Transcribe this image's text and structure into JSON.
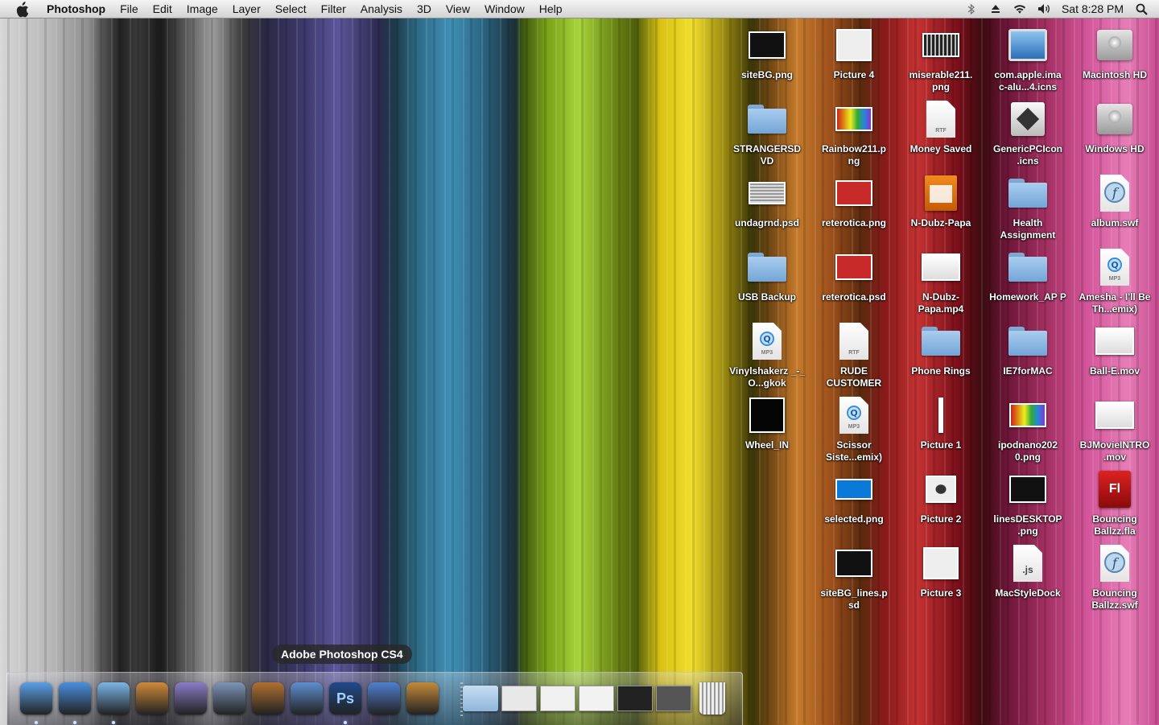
{
  "menubar": {
    "app_name": "Photoshop",
    "menus": [
      "File",
      "Edit",
      "Image",
      "Layer",
      "Select",
      "Filter",
      "Analysis",
      "3D",
      "View",
      "Window",
      "Help"
    ],
    "clock": "Sat 8:28 PM"
  },
  "desktop_icons": [
    {
      "label": "siteBG.png",
      "icon": "image-thumbnail-dark"
    },
    {
      "label": "STRANGERSD VD",
      "icon": "folder-icon"
    },
    {
      "label": "undagrnd.psd",
      "icon": "image-thumbnail-silver"
    },
    {
      "label": "USB Backup",
      "icon": "folder-icon"
    },
    {
      "label": "Vinylshakerz _-_ O...gkok",
      "icon": "mp3-file-icon"
    },
    {
      "label": "Wheel_IN",
      "icon": "image-thumbnail-black"
    },
    {
      "label": "Picture 4",
      "icon": "image-thumbnail-white"
    },
    {
      "label": "Rainbow211.p ng",
      "icon": "image-thumbnail-rainbow"
    },
    {
      "label": "reterotica.png",
      "icon": "image-thumbnail-red"
    },
    {
      "label": "reterotica.psd",
      "icon": "image-thumbnail-red"
    },
    {
      "label": "RUDE CUSTOMER",
      "icon": "rtf-file-icon"
    },
    {
      "label": "Scissor Siste...emix)",
      "icon": "mp3-file-icon"
    },
    {
      "label": "selected.png",
      "icon": "image-thumbnail-blue"
    },
    {
      "label": "siteBG_lines.p sd",
      "icon": "image-thumbnail-dark"
    },
    {
      "label": "miserable211. png",
      "icon": "image-thumbnail-stripes"
    },
    {
      "label": "Money Saved",
      "icon": "rtf-file-icon"
    },
    {
      "label": "N-Dubz-Papa",
      "icon": "flv-file-icon"
    },
    {
      "label": "N-Dubz- Papa.mp4",
      "icon": "video-thumbnail"
    },
    {
      "label": "Phone Rings",
      "icon": "folder-icon"
    },
    {
      "label": "Picture 1",
      "icon": "image-thumbnail-thin"
    },
    {
      "label": "Picture 2",
      "icon": "image-thumbnail-dial"
    },
    {
      "label": "Picture 3",
      "icon": "image-thumbnail-white"
    },
    {
      "label": "com.apple.ima c-alu...4.icns",
      "icon": "imac-icon"
    },
    {
      "label": "GenericPCIcon .icns",
      "icon": "pc-icon"
    },
    {
      "label": "Health Assignment",
      "icon": "folder-icon"
    },
    {
      "label": "Homework_AP P",
      "icon": "folder-icon"
    },
    {
      "label": "IE7forMAC",
      "icon": "folder-icon"
    },
    {
      "label": "ipodnano202 0.png",
      "icon": "image-thumbnail-rainbow"
    },
    {
      "label": "linesDESKTOP .png",
      "icon": "image-thumbnail-dark"
    },
    {
      "label": "MacStyleDock",
      "icon": "js-file-icon"
    },
    {
      "label": "Macintosh HD",
      "icon": "hard-disk-icon"
    },
    {
      "label": "Windows HD",
      "icon": "hard-disk-icon"
    },
    {
      "label": "album.swf",
      "icon": "swf-file-icon"
    },
    {
      "label": "Amesha - I'll Be Th...emix)",
      "icon": "mp3-file-icon"
    },
    {
      "label": "Ball-E.mov",
      "icon": "video-thumbnail"
    },
    {
      "label": "BJMovieINTRO .mov",
      "icon": "video-thumbnail"
    },
    {
      "label": "Bouncing Ballzz.fla",
      "icon": "fla-file-icon"
    },
    {
      "label": "Bouncing Ballzz.swf",
      "icon": "swf-file-icon"
    }
  ],
  "dock": {
    "tooltip": "Adobe Photoshop CS4",
    "apps": [
      {
        "name": "finder-icon",
        "running": true,
        "color": "#5aa0e8"
      },
      {
        "name": "safari-icon",
        "running": true,
        "color": "#4a8fe0"
      },
      {
        "name": "itunes-icon",
        "running": true,
        "color": "#7ab6e8"
      },
      {
        "name": "iphoto-icon",
        "running": false,
        "color": "#d08a3a"
      },
      {
        "name": "script-editor-icon",
        "running": false,
        "color": "#8a7cc8"
      },
      {
        "name": "preview-icon",
        "running": false,
        "color": "#7d94b8"
      },
      {
        "name": "keynote-icon",
        "running": false,
        "color": "#b07030"
      },
      {
        "name": "xcode-icon",
        "running": false,
        "color": "#5e8fd0"
      },
      {
        "name": "photoshop-icon",
        "running": true,
        "color": "#1f4a8a",
        "text": "Ps"
      },
      {
        "name": "dashcode-icon",
        "running": false,
        "color": "#4f7fd0"
      },
      {
        "name": "pages-icon",
        "running": false,
        "color": "#c48a3a"
      }
    ],
    "stacks": [
      {
        "name": "downloads-stack-icon",
        "color": "#a0c4e6"
      },
      {
        "name": "minimized-window-1",
        "color": "#e8e8e8"
      },
      {
        "name": "minimized-window-2",
        "color": "#f0f0f0"
      },
      {
        "name": "minimized-window-3",
        "color": "#f2f2f2"
      },
      {
        "name": "minimized-window-4",
        "color": "#222222"
      },
      {
        "name": "minimized-window-5",
        "color": "#555555"
      },
      {
        "name": "trash-icon",
        "color": "#cfcfcf"
      }
    ]
  }
}
